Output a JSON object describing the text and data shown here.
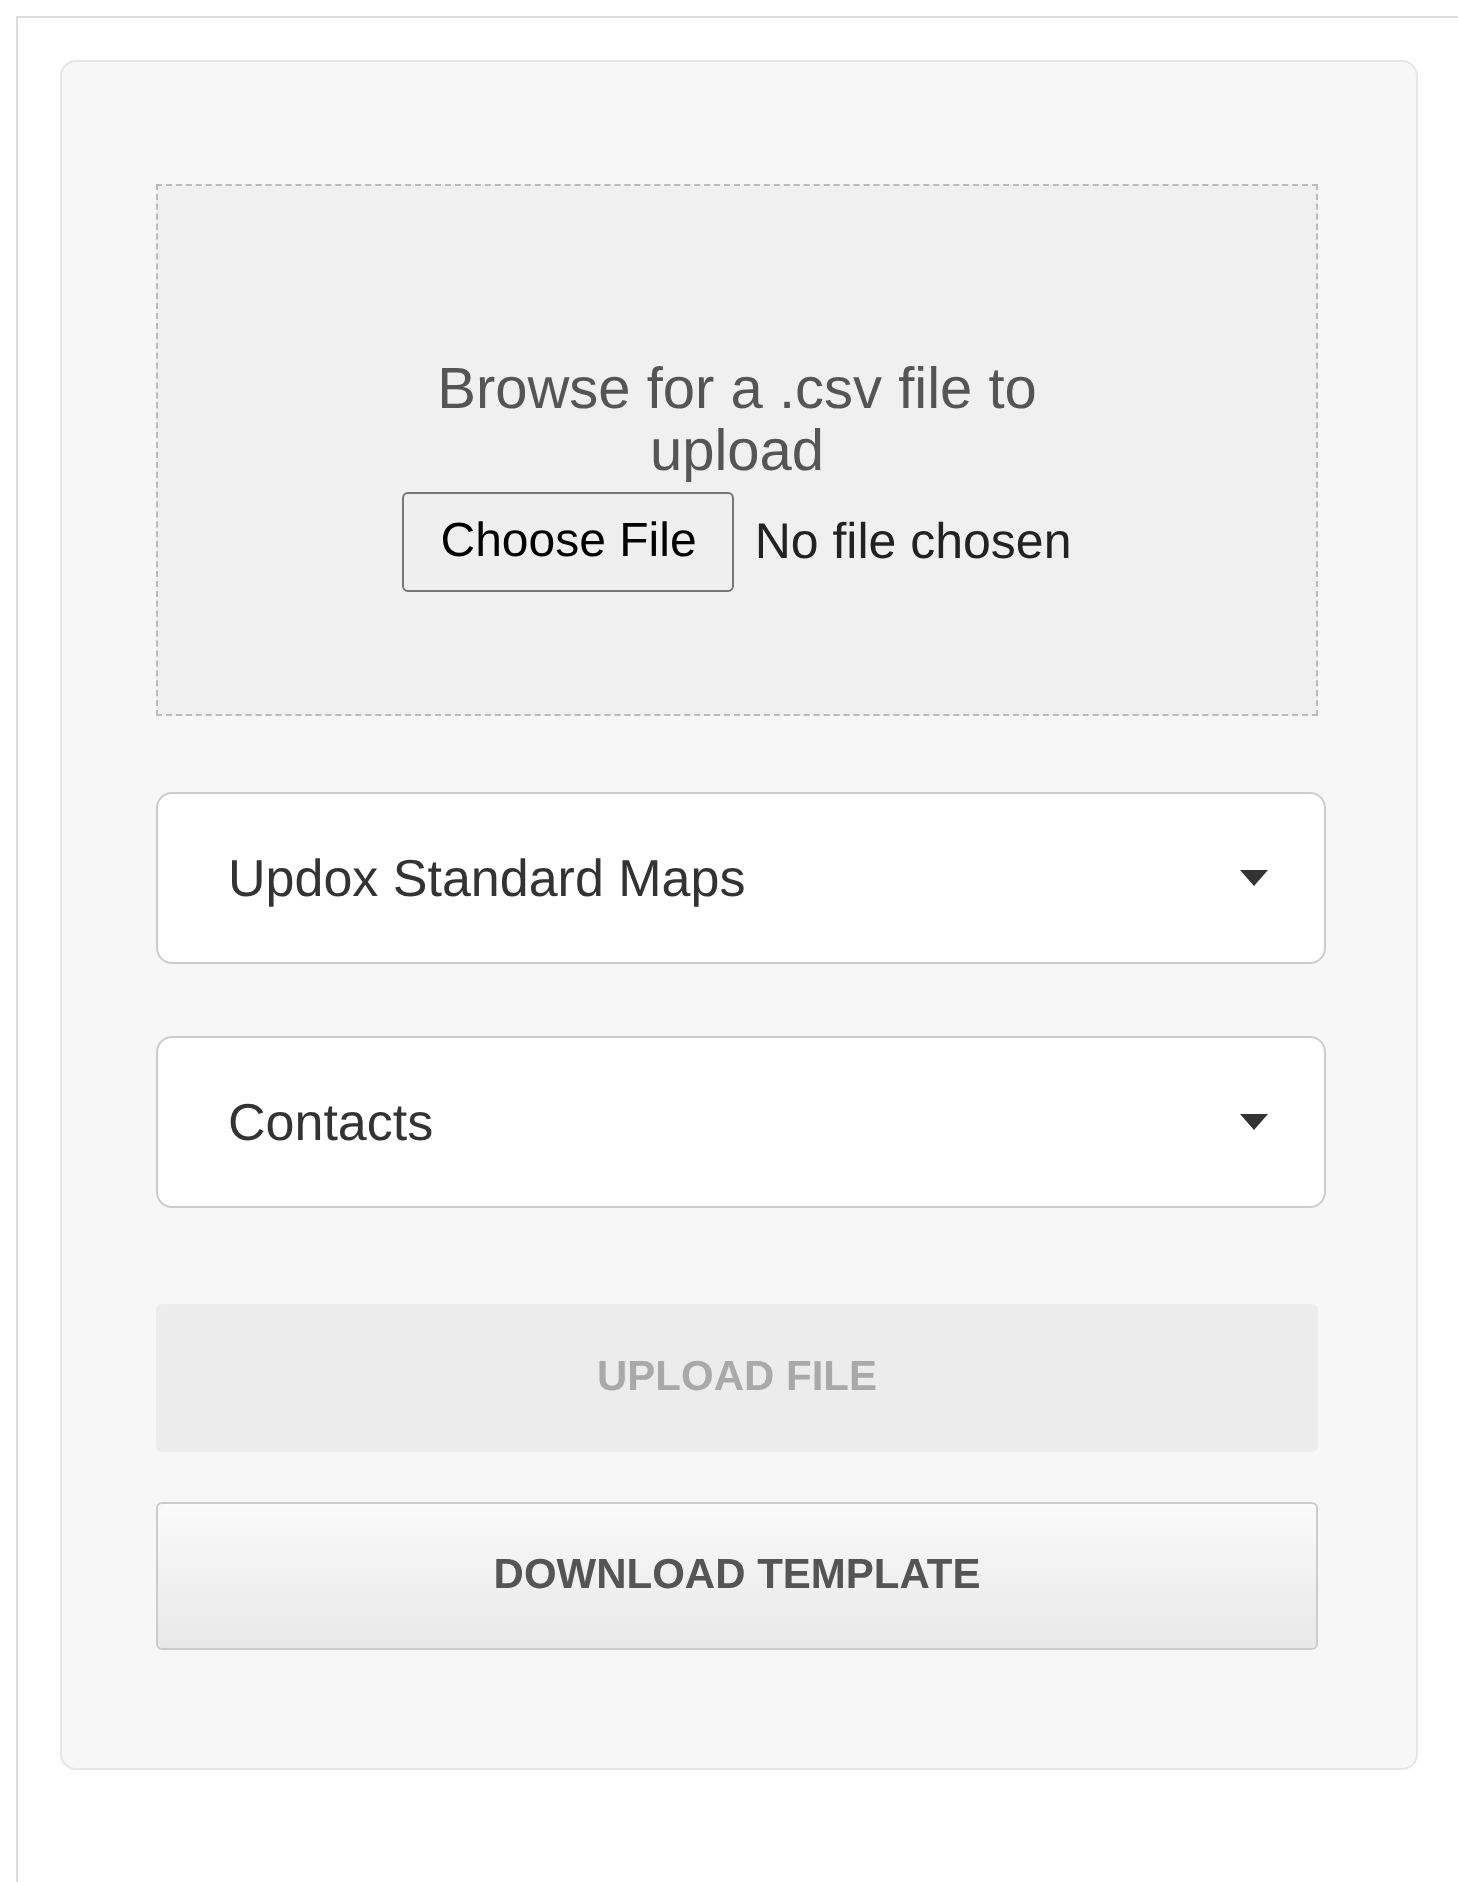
{
  "upload": {
    "prompt": "Browse for a .csv file to upload",
    "file_button": "Choose File",
    "file_status": "No file chosen"
  },
  "selects": [
    {
      "value": "Updox Standard Maps"
    },
    {
      "value": "Contacts"
    }
  ],
  "buttons": [
    {
      "label": "UPLOAD FILE",
      "disabled": true
    },
    {
      "label": "DOWNLOAD TEMPLATE",
      "disabled": false
    }
  ]
}
